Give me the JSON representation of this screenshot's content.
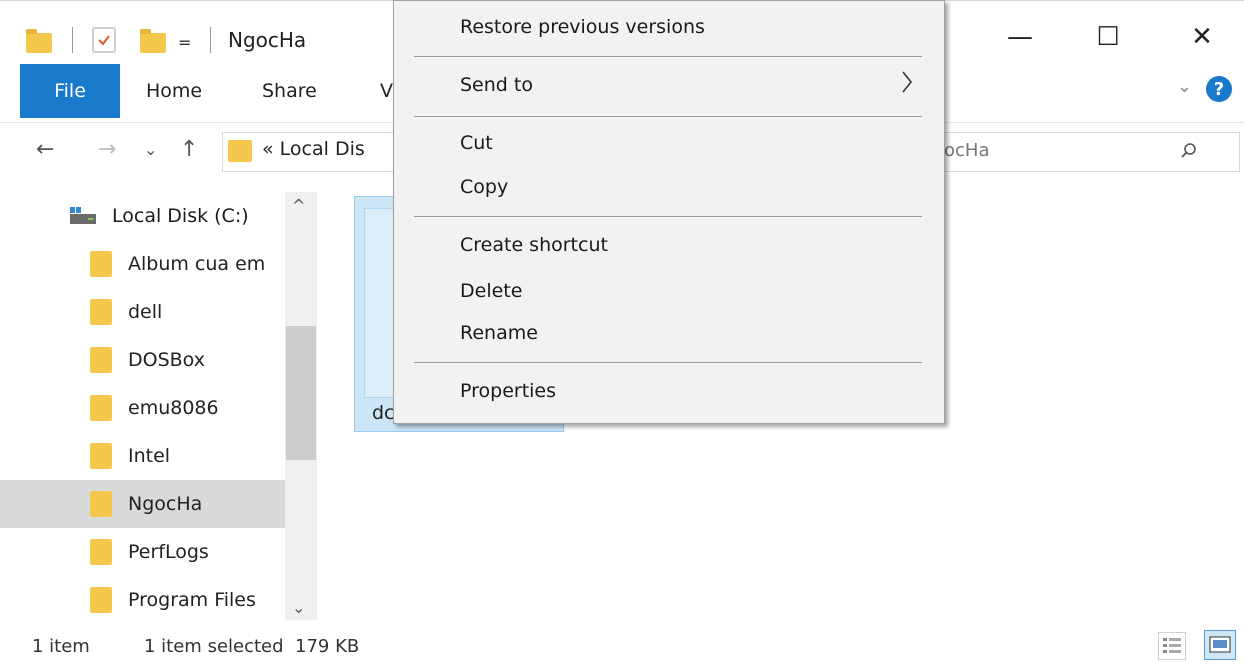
{
  "window": {
    "title": "NgocHa",
    "quick_access_dropdown": "=",
    "minimize": "—",
    "maximize": "☐",
    "close": "✕"
  },
  "ribbon": {
    "tabs": [
      {
        "label": "File",
        "active": true
      },
      {
        "label": "Home"
      },
      {
        "label": "Share"
      },
      {
        "label": "V"
      }
    ],
    "help": "?",
    "chevron": "⌄"
  },
  "address_bar": {
    "back": "←",
    "forward": "→",
    "recent": "⌄",
    "up": "↑",
    "path_text": "« Local Dis",
    "search_text": "ocHa"
  },
  "navigation_pane": {
    "drive": "Local Disk (C:)",
    "folders": [
      {
        "label": "Album cua em"
      },
      {
        "label": "dell"
      },
      {
        "label": "DOSBox"
      },
      {
        "label": "emu8086"
      },
      {
        "label": "Intel"
      },
      {
        "label": "NgocHa",
        "selected": true
      },
      {
        "label": "PerfLogs"
      },
      {
        "label": "Program Files"
      }
    ],
    "scroll_up": "^",
    "scroll_down": "⌄"
  },
  "content": {
    "selected_file_name": "dc"
  },
  "context_menu": {
    "items": [
      {
        "label": "Restore previous versions"
      },
      {
        "label": "Send to",
        "submenu": true
      },
      {
        "label": "Cut"
      },
      {
        "label": "Copy"
      },
      {
        "label": "Create shortcut"
      },
      {
        "label": "Delete"
      },
      {
        "label": "Rename"
      },
      {
        "label": "Properties"
      }
    ]
  },
  "status_bar": {
    "item_count": "1 item",
    "selection": "1 item selected  179 KB"
  },
  "colors": {
    "accent": "#1979ca",
    "folder": "#f3c84b",
    "selection": "#cce6f7",
    "menu_bg": "#f2f2f2"
  }
}
